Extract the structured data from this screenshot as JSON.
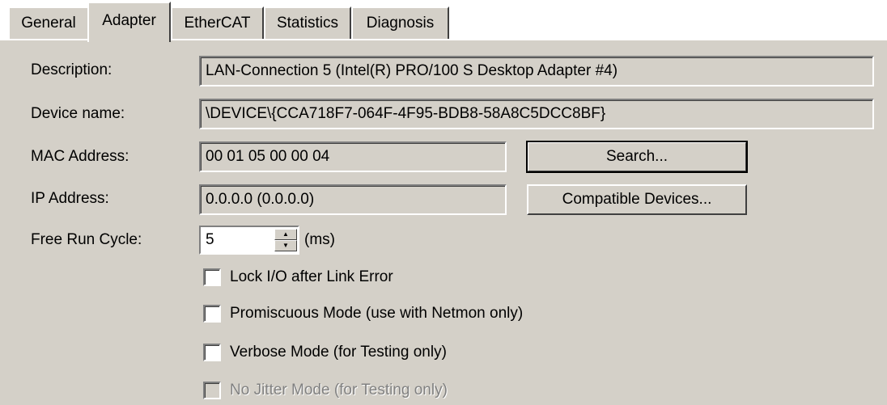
{
  "tabs": [
    {
      "label": "General",
      "active": false
    },
    {
      "label": "Adapter",
      "active": true
    },
    {
      "label": "EtherCAT",
      "active": false
    },
    {
      "label": "Statistics",
      "active": false
    },
    {
      "label": "Diagnosis",
      "active": false
    }
  ],
  "adapter": {
    "description_label": "Description:",
    "description_value": "LAN-Connection 5 (Intel(R) PRO/100 S Desktop Adapter #4)",
    "device_name_label": "Device name:",
    "device_name_value": "\\DEVICE\\{CCA718F7-064F-4F95-BDB8-58A8C5DCC8BF}",
    "mac_label": "MAC Address:",
    "mac_value": "00 01 05 00 00 04",
    "search_button": "Search...",
    "ip_label": "IP Address:",
    "ip_value": "0.0.0.0 (0.0.0.0)",
    "compatible_button": "Compatible Devices...",
    "free_run_label": "Free Run Cycle:",
    "free_run_value": "5",
    "free_run_unit": "(ms)"
  },
  "options": [
    {
      "label": "Lock I/O after Link Error",
      "checked": false,
      "enabled": true
    },
    {
      "label": "Promiscuous Mode (use with Netmon only)",
      "checked": false,
      "enabled": true
    },
    {
      "label": "Verbose Mode (for Testing only)",
      "checked": false,
      "enabled": true
    },
    {
      "label": "No Jitter Mode (for Testing only)",
      "checked": false,
      "enabled": false
    }
  ],
  "colors": {
    "face": "#d4d0c8",
    "highlight": "#ffffff",
    "shadow": "#808080",
    "dark_shadow": "#404040",
    "disabled_text": "#808080"
  }
}
